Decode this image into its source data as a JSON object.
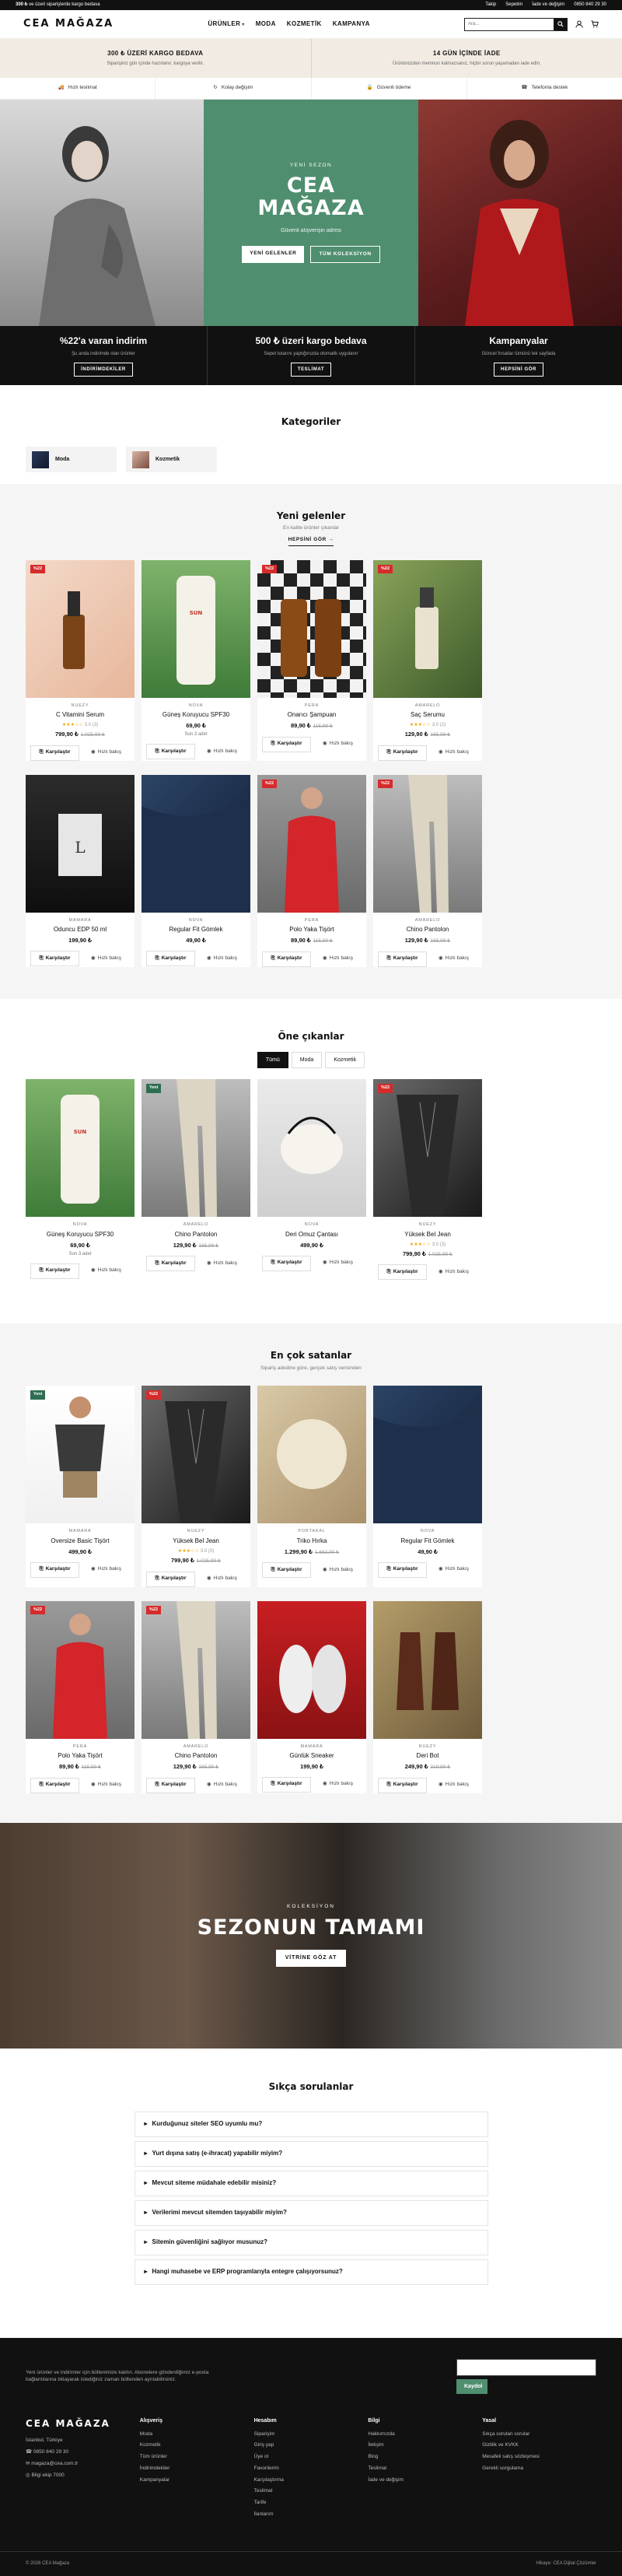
{
  "topbar": {
    "announce_amount": "300 ₺",
    "announce_rest": "ve üzeri siparişlerde kargo bedava",
    "links": [
      "Takip",
      "Sepetim",
      "İade ve değişim"
    ],
    "phone": "0850 840 29 30"
  },
  "header": {
    "logo": "CEA MAĞAZA",
    "nav": [
      "ÜRÜNLER",
      "MODA",
      "KOZMETİK",
      "KAMPANYA"
    ],
    "search_placeholder": "Ara..."
  },
  "shipping_strip": [
    {
      "title": "300 ₺ ÜZERİ KARGO BEDAVA",
      "sub": "Siparişiniz gün içinde hazırlanır, kargoya verilir."
    },
    {
      "title": "14 GÜN İÇİNDE İADE",
      "sub": "Ürününüzden memnun kalmazsanız, hiçbir sorun yaşamadan iade edin."
    }
  ],
  "usp": [
    {
      "icon": "truck-icon",
      "label": "Hızlı teslimat"
    },
    {
      "icon": "refresh-icon",
      "label": "Kolay değişim"
    },
    {
      "icon": "lock-icon",
      "label": "Güvenli ödeme"
    },
    {
      "icon": "headset-icon",
      "label": "Telefonla destek"
    }
  ],
  "hero": {
    "kicker": "YENİ SEZON",
    "title": "CEA MAĞAZA",
    "sub": "Güvenli alışverişin adresi",
    "btn_primary": "YENİ GELENLER",
    "btn_secondary": "TÜM KOLEKSİYON"
  },
  "campaigns": [
    {
      "title": "%22'a varan indirim",
      "sub": "Şu anda indirimde olan ürünler",
      "btn": "İNDİRİMDEKİLER"
    },
    {
      "title": "500 ₺ üzeri kargo bedava",
      "sub": "Sepet tutarını yaptığınızda otomatik uygulanır",
      "btn": "TESLİMAT"
    },
    {
      "title": "Kampanyalar",
      "sub": "Güncel fırsatlar tümünü tek sayfada",
      "btn": "HEPSİNİ GÖR"
    }
  ],
  "categories": {
    "title": "Kategoriler",
    "items": [
      "Moda",
      "Kozmetik"
    ]
  },
  "new_arrivals": {
    "title": "Yeni gelenler",
    "sub": "En kalite ürünler çıkarılar",
    "more": "HEPSİNİ GÖR",
    "products": [
      {
        "badge": "%22",
        "badge_type": "sale",
        "brand": "NUEZY",
        "name": "C Vitamini Serum",
        "rating": "★★★☆☆",
        "rcount": "3.0 (3)",
        "price": "799,90 ₺",
        "old": "1.025,99 ₺",
        "stock": "",
        "bg": "peach"
      },
      {
        "badge": "",
        "badge_type": "",
        "brand": "NOVA",
        "name": "Güneş Koruyucu SPF30",
        "rating": "",
        "rcount": "",
        "price": "69,90 ₺",
        "old": "",
        "stock": "Son 3 adet",
        "bg": "green"
      },
      {
        "badge": "%22",
        "badge_type": "sale",
        "brand": "PERA",
        "name": "Onarıcı Şampuan",
        "rating": "",
        "rcount": "",
        "price": "89,90 ₺",
        "old": "115,99 ₺",
        "stock": "",
        "bg": "checker"
      },
      {
        "badge": "%22",
        "badge_type": "sale",
        "brand": "AMARELO",
        "name": "Saç Serumu",
        "rating": "★★★☆☆",
        "rcount": "3.0 (2)",
        "price": "129,90 ₺",
        "old": "165,99 ₺",
        "stock": "",
        "bg": "olive"
      },
      {
        "badge": "",
        "badge_type": "",
        "brand": "MAMARA",
        "name": "Oduncu EDP 50 ml",
        "rating": "",
        "rcount": "",
        "price": "199,90 ₺",
        "old": "",
        "stock": "",
        "bg": "dark"
      },
      {
        "badge": "",
        "badge_type": "",
        "brand": "NOVA",
        "name": "Regular Fit Gömlek",
        "rating": "",
        "rcount": "",
        "price": "49,90 ₺",
        "old": "",
        "stock": "",
        "bg": "navy"
      },
      {
        "badge": "%22",
        "badge_type": "sale",
        "brand": "PERA",
        "name": "Polo Yaka Tişört",
        "rating": "",
        "rcount": "",
        "price": "89,90 ₺",
        "old": "115,99 ₺",
        "stock": "",
        "bg": "red"
      },
      {
        "badge": "%22",
        "badge_type": "sale",
        "brand": "AMARELO",
        "name": "Chino Pantolon",
        "rating": "",
        "rcount": "",
        "price": "129,90 ₺",
        "old": "165,99 ₺",
        "stock": "",
        "bg": "stone"
      }
    ]
  },
  "featured": {
    "title": "Öne çıkanlar",
    "tabs": [
      "Tümü",
      "Moda",
      "Kozmetik"
    ],
    "products": [
      {
        "badge": "",
        "badge_type": "",
        "brand": "NOVA",
        "name": "Güneş Koruyucu SPF30",
        "rating": "",
        "rcount": "",
        "price": "69,90 ₺",
        "old": "",
        "stock": "Son 3 adet",
        "bg": "green"
      },
      {
        "badge": "Yeni",
        "badge_type": "new",
        "brand": "AMARELO",
        "name": "Chino Pantolon",
        "rating": "",
        "rcount": "",
        "price": "129,90 ₺",
        "old": "165,99 ₺",
        "stock": "",
        "bg": "stone"
      },
      {
        "badge": "",
        "badge_type": "",
        "brand": "NOVA",
        "name": "Deri Omuz Çantası",
        "rating": "",
        "rcount": "",
        "price": "499,90 ₺",
        "old": "",
        "stock": "",
        "bg": "bag"
      },
      {
        "badge": "%22",
        "badge_type": "sale",
        "brand": "NUEZY",
        "name": "Yüksek Bel Jean",
        "rating": "★★★☆☆",
        "rcount": "3.0 (3)",
        "price": "799,90 ₺",
        "old": "1.025,99 ₺",
        "stock": "",
        "bg": "bw"
      }
    ]
  },
  "bestsellers": {
    "title": "En çok satanlar",
    "sub": "Sipariş adedine göre, gerçek satış verisinden",
    "products": [
      {
        "badge": "Yeni",
        "badge_type": "new",
        "brand": "MAMARA",
        "name": "Oversize Basic Tişört",
        "rating": "",
        "rcount": "",
        "price": "499,90 ₺",
        "old": "",
        "stock": "",
        "bg": "white"
      },
      {
        "badge": "%22",
        "badge_type": "sale",
        "brand": "NUEZY",
        "name": "Yüksek Bel Jean",
        "rating": "★★★☆☆",
        "rcount": "3.0 (3)",
        "price": "799,90 ₺",
        "old": "1.025,99 ₺",
        "stock": "",
        "bg": "bw"
      },
      {
        "badge": "",
        "badge_type": "",
        "brand": "PORTAKAL",
        "name": "Triko Hırka",
        "rating": "",
        "rcount": "",
        "price": "1.299,90 ₺",
        "old": "1.663,99 ₺",
        "stock": "",
        "bg": "knit"
      },
      {
        "badge": "",
        "badge_type": "",
        "brand": "NOVA",
        "name": "Regular Fit Gömlek",
        "rating": "",
        "rcount": "",
        "price": "49,90 ₺",
        "old": "",
        "stock": "",
        "bg": "navy"
      },
      {
        "badge": "%22",
        "badge_type": "sale",
        "brand": "PERA",
        "name": "Polo Yaka Tişört",
        "rating": "",
        "rcount": "",
        "price": "89,90 ₺",
        "old": "115,99 ₺",
        "stock": "",
        "bg": "red"
      },
      {
        "badge": "%22",
        "badge_type": "sale",
        "brand": "AMARELO",
        "name": "Chino Pantolon",
        "rating": "",
        "rcount": "",
        "price": "129,90 ₺",
        "old": "165,99 ₺",
        "stock": "",
        "bg": "stone"
      },
      {
        "badge": "",
        "badge_type": "",
        "brand": "MAMARA",
        "name": "Günlük Sneaker",
        "rating": "",
        "rcount": "",
        "price": "199,90 ₺",
        "old": "",
        "stock": "",
        "bg": "shoe"
      },
      {
        "badge": "",
        "badge_type": "",
        "brand": "NUEZY",
        "name": "Deri Bot",
        "rating": "",
        "rcount": "",
        "price": "249,90 ₺",
        "old": "319,99 ₺",
        "stock": "",
        "bg": "boot"
      }
    ]
  },
  "banner": {
    "kicker": "KOLEKSİYON",
    "title": "SEZONUN TAMAMI",
    "btn": "VİTRİNE GÖZ AT"
  },
  "faq": {
    "title": "Sıkça sorulanlar",
    "items": [
      "Kurduğunuz siteler SEO uyumlu mu?",
      "Yurt dışına satış (e-ihracat) yapabilir miyim?",
      "Mevcut siteme müdahale edebilir misiniz?",
      "Verilerimi mevcut sitemden taşıyabilir miyim?",
      "Sitemin güvenliğini sağlıyor musunuz?",
      "Hangi muhasebe ve ERP programlarıyla entegre çalışıyorsunuz?"
    ]
  },
  "footer": {
    "news_text": "Yeni ürünler ve indirimler için bültenimize katılın. Abonelere gönderdiğimiz e-posta bağlantılarına tıklayarak istediğiniz zaman bültenden ayrılabilirsiniz.",
    "subscribe": "Kaydol",
    "logo": "CEA MAĞAZA",
    "contact": [
      "İstanbul, Türkiye",
      "0850 840 29 30",
      "magaza@cea.com.tr",
      "Bilgi ekip 7000"
    ],
    "columns": [
      {
        "title": "Alışveriş",
        "links": [
          "Moda",
          "Kozmetik",
          "Tüm ürünler",
          "İndirimdekiler",
          "Kampanyalar"
        ]
      },
      {
        "title": "Hesabım",
        "links": [
          "Siparişim",
          "Giriş yap",
          "Üye ol",
          "Favorilerim",
          "Karşılaştırma",
          "Teslimat",
          "Tarife",
          "İlanlarım"
        ]
      },
      {
        "title": "Bilgi",
        "links": [
          "Hakkımızda",
          "İletişim",
          "Blog",
          "Teslimat",
          "İade ve değişim"
        ]
      },
      {
        "title": "Yasal",
        "links": [
          "Sıkça sorulan sorular",
          "Gizlilik ve KVKK",
          "Mesafeli satış sözleşmesi",
          "Gerekli sorgulama"
        ]
      }
    ],
    "copyright": "© 2026 CEA Mağaza",
    "credit": "Hikaye: CEA Dijital Çözümler"
  },
  "card_labels": {
    "add": "Karşılaştır",
    "quick": "Hızlı bakış"
  }
}
